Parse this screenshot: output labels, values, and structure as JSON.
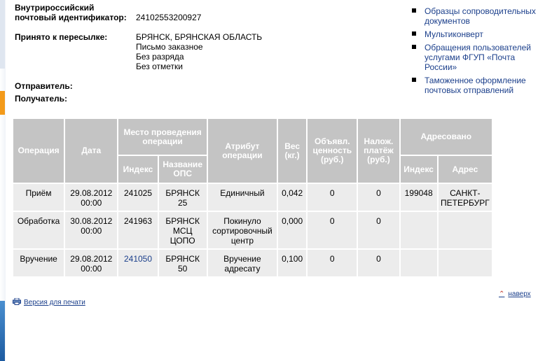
{
  "shipment": {
    "id_label_line1": "Внутрироссийский",
    "id_label_line2": "почтовый идентификатор:",
    "id_value": "24102553200927",
    "accepted_label": "Принято к пересылке:",
    "accepted_lines": [
      "БРЯНСК, БРЯНСКАЯ ОБЛАСТЬ",
      "Письмо заказное",
      "Без разряда",
      "Без отметки"
    ],
    "sender_label": "Отправитель:",
    "recipient_label": "Получатель:"
  },
  "right_links": [
    "Образцы сопроводительных документов",
    "Мультиконверт",
    "Обращения пользователей услугами ФГУП «Почта России»",
    "Таможенное оформление почтовых отправлений"
  ],
  "table": {
    "headers": {
      "operation": "Операция",
      "date": "Дата",
      "place": "Место проведения операции",
      "index": "Индекс",
      "ops_name": "Название ОПС",
      "attribute": "Атрибут операции",
      "weight": "Вес (кг.)",
      "declared": "Объявл. ценность (руб.)",
      "cod": "Налож. платёж (руб.)",
      "addressed": "Адресовано",
      "addr_index": "Индекс",
      "address": "Адрес"
    },
    "rows": [
      {
        "operation": "Приём",
        "date": "29.08.2012 00:00",
        "index": "241025",
        "ops_name": "БРЯНСК 25",
        "attribute": "Единичный",
        "weight": "0,042",
        "declared": "0",
        "cod": "0",
        "addr_index": "199048",
        "address": "САНКТ-ПЕТЕРБУРГ"
      },
      {
        "operation": "Обработка",
        "date": "30.08.2012 00:00",
        "index": "241963",
        "ops_name": "БРЯНСК МСЦ ЦОПО",
        "attribute": "Покинуло сортировочный центр",
        "weight": "0,000",
        "declared": "0",
        "cod": "0",
        "addr_index": "",
        "address": ""
      },
      {
        "operation": "Вручение",
        "date": "29.08.2012 00:00",
        "index": "241050",
        "ops_name": "БРЯНСК 50",
        "attribute": "Вручение адресату",
        "weight": "0,100",
        "declared": "0",
        "cod": "0",
        "addr_index": "",
        "address": ""
      }
    ]
  },
  "footer": {
    "print_label": "Версия для печати",
    "up_label": "наверх"
  },
  "icons": {
    "bullet": "square-bullet-icon",
    "print": "printer-icon",
    "up": "double-chevron-up-icon"
  },
  "colors": {
    "link": "#1b3f8b",
    "header_bg": "#c4c4c4",
    "row_bg": "#ececec",
    "accent_orange": "#f39a1a"
  }
}
